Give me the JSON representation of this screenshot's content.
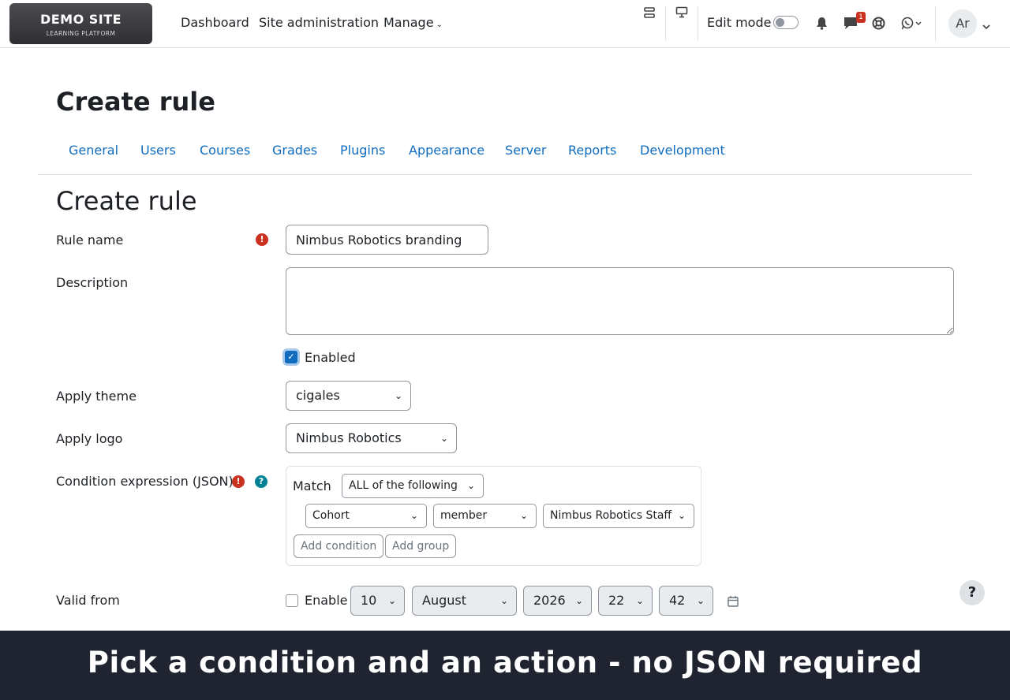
{
  "brand": {
    "title": "DEMO SITE",
    "subtitle": "LEARNING PLATFORM"
  },
  "nav": {
    "links": [
      "Dashboard",
      "Site administration",
      "Manage"
    ],
    "edit_mode_label": "Edit mode",
    "edit_mode_on": false,
    "messages_badge": "1",
    "user_initials": "Ar"
  },
  "page": {
    "title": "Create rule"
  },
  "tabs": [
    "General",
    "Users",
    "Courses",
    "Grades",
    "Plugins",
    "Appearance",
    "Server",
    "Reports",
    "Development"
  ],
  "form": {
    "heading": "Create rule",
    "rule_name": {
      "label": "Rule name",
      "value": "Nimbus Robotics branding",
      "required_icon": "!"
    },
    "description": {
      "label": "Description",
      "value": ""
    },
    "enabled": {
      "label": "Enabled",
      "checked": true
    },
    "apply_theme": {
      "label": "Apply theme",
      "value": "cigales"
    },
    "apply_logo": {
      "label": "Apply logo",
      "value": "Nimbus Robotics"
    },
    "condition": {
      "label": "Condition expression (JSON)",
      "required_icon": "!",
      "help_icon": "?",
      "match_label": "Match",
      "match_value": "ALL of the following",
      "field": "Cohort",
      "operator": "member",
      "value": "Nimbus Robotics Staff",
      "add_condition": "Add condition",
      "add_group": "Add group"
    },
    "valid_from": {
      "label": "Valid from",
      "enable_label": "Enable",
      "enabled": false,
      "day": "10",
      "month": "August",
      "year": "2026",
      "hour": "22",
      "minute": "42"
    }
  },
  "help_button": "?",
  "caption": "Pick a condition and an action - no JSON required",
  "colors": {
    "link": "#0f6cbf",
    "required": "#ca3120",
    "help": "#008196",
    "caption_bg": "#1f2430"
  }
}
